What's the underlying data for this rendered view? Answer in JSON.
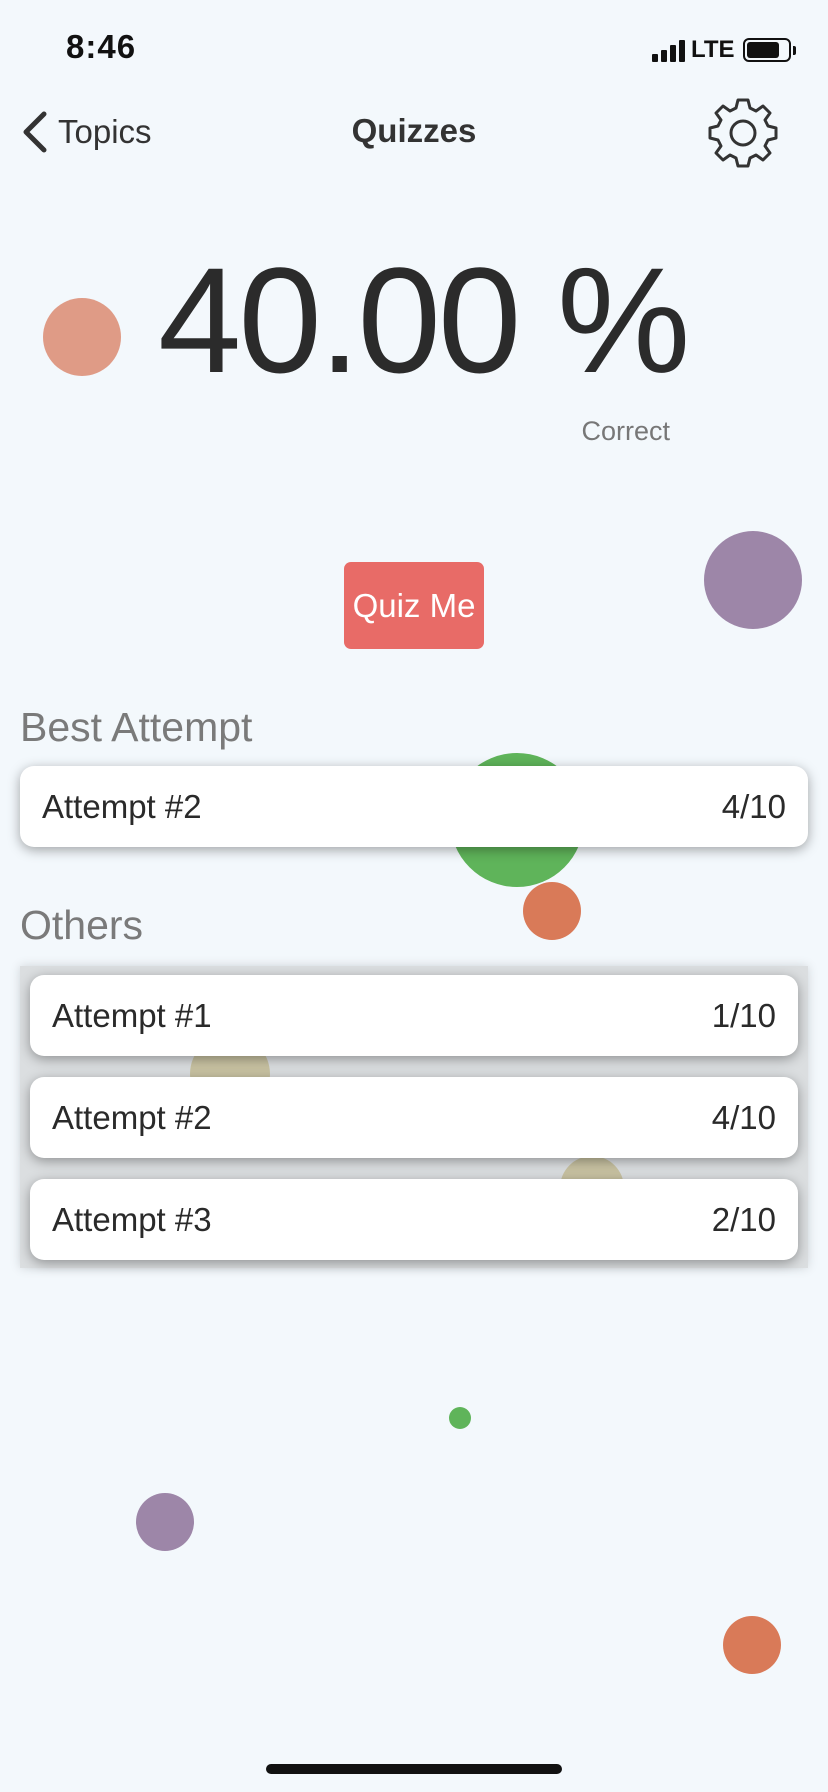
{
  "status_bar": {
    "time": "8:46",
    "network": "LTE"
  },
  "nav": {
    "back_label": "Topics",
    "title": "Quizzes",
    "back_icon": "chevron-left-icon",
    "settings_icon": "gear-icon"
  },
  "score": {
    "value": "40.00 %",
    "caption": "Correct"
  },
  "quiz_button": {
    "label": "Quiz Me",
    "color": "#e86b67"
  },
  "best_attempt": {
    "heading": "Best Attempt",
    "label": "Attempt #2",
    "score": "4/10"
  },
  "others": {
    "heading": "Others",
    "items": [
      {
        "label": "Attempt #1",
        "score": "1/10"
      },
      {
        "label": "Attempt #2",
        "score": "4/10"
      },
      {
        "label": "Attempt #3",
        "score": "2/10"
      }
    ]
  },
  "colors": {
    "background": "#f3f8fc",
    "accent": "#e86b67",
    "bubble_salmon": "#df9b86",
    "bubble_purple": "#9d86a8",
    "bubble_green": "#5fb45a",
    "bubble_orange": "#d97a58",
    "bubble_yellow": "#cfc58a"
  }
}
